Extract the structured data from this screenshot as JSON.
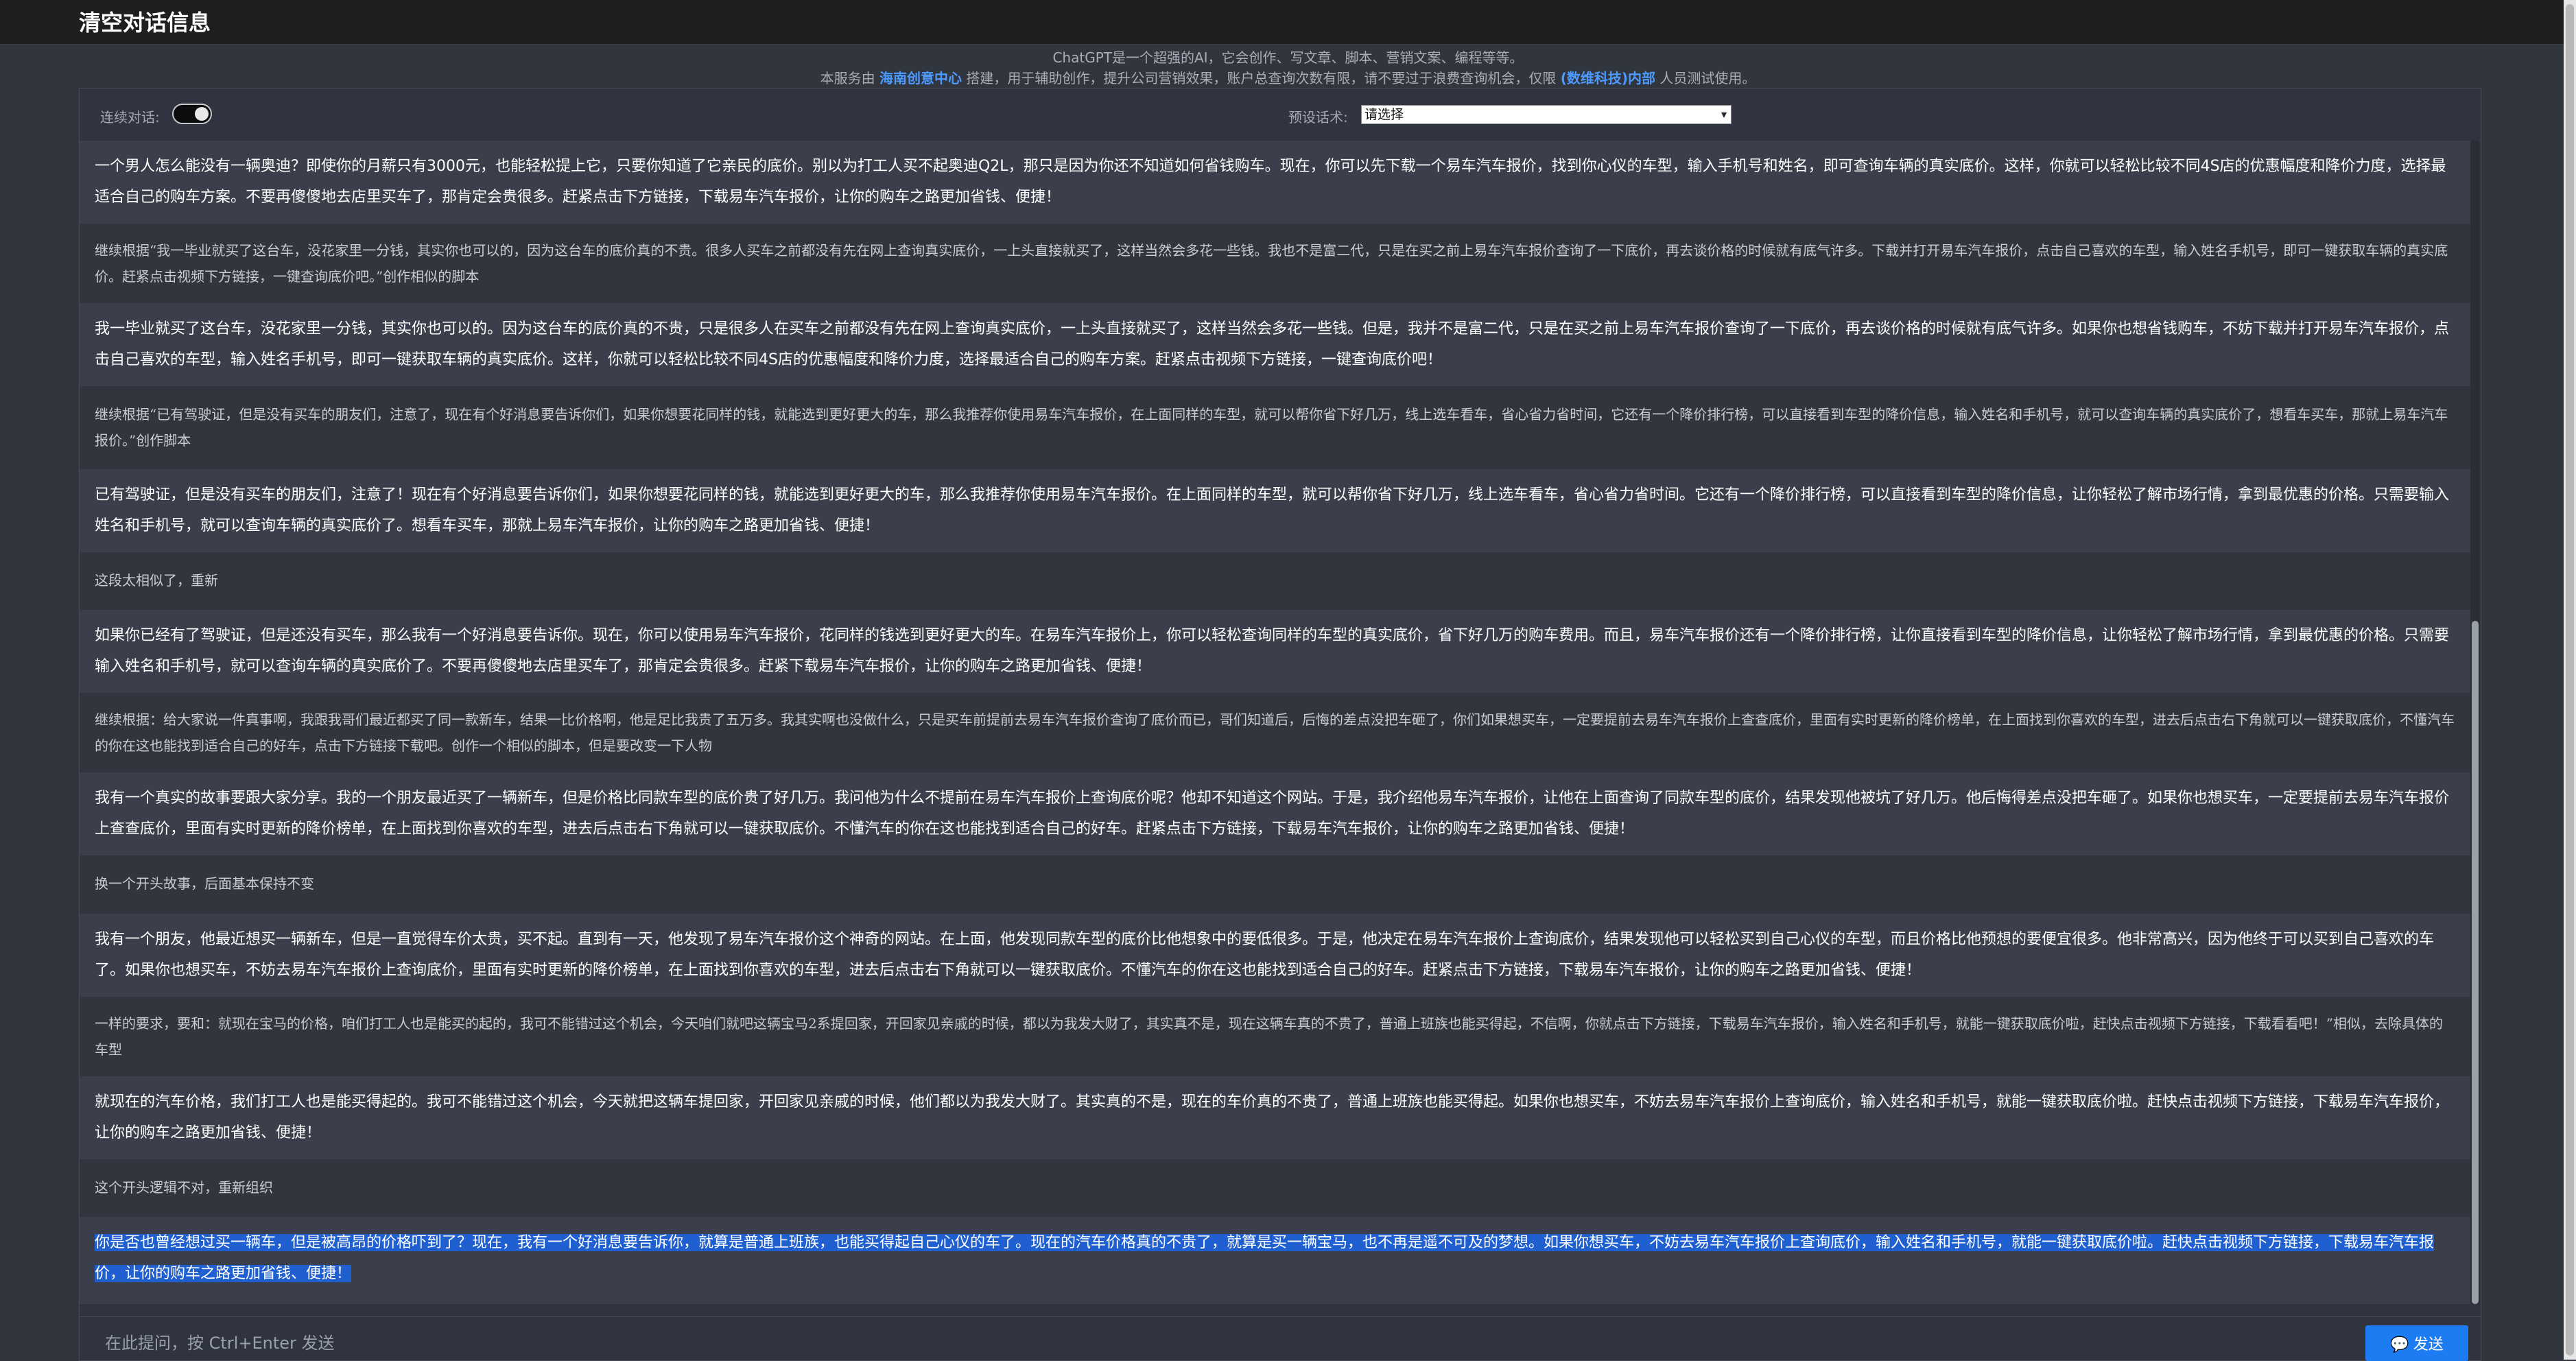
{
  "header": {
    "title": "清空对话信息"
  },
  "notice": {
    "line1": "ChatGPT是一个超强的AI，它会创作、写文章、脚本、营销文案、编程等等。",
    "line2_pre": "本服务由",
    "line2_link1": "海南创意中心",
    "line2_mid": "搭建，用于辅助创作，提升公司营销效果，账户总查询次数有限，请不要过于浪费查询机会，仅限",
    "line2_link2": "(数维科技)内部",
    "line2_post": "人员测试使用。"
  },
  "options": {
    "continuous_label": "连续对话:",
    "preset_label": "预设话术:",
    "preset_value": "请选择"
  },
  "messages": [
    {
      "role": "assistant",
      "text": "一个男人怎么能没有一辆奥迪？即使你的月薪只有3000元，也能轻松提上它，只要你知道了它亲民的底价。别以为打工人买不起奥迪Q2L，那只是因为你还不知道如何省钱购车。现在，你可以先下载一个易车汽车报价，找到你心仪的车型，输入手机号和姓名，即可查询车辆的真实底价。这样，你就可以轻松比较不同4S店的优惠幅度和降价力度，选择最适合自己的购车方案。不要再傻傻地去店里买车了，那肯定会贵很多。赶紧点击下方链接，下载易车汽车报价，让你的购车之路更加省钱、便捷！"
    },
    {
      "role": "user",
      "text": "继续根据“我一毕业就买了这台车，没花家里一分钱，其实你也可以的，因为这台车的底价真的不贵。很多人买车之前都没有先在网上查询真实底价，一上头直接就买了，这样当然会多花一些钱。我也不是富二代，只是在买之前上易车汽车报价查询了一下底价，再去谈价格的时候就有底气许多。下载并打开易车汽车报价，点击自己喜欢的车型，输入姓名手机号，即可一键获取车辆的真实底价。赶紧点击视频下方链接，一键查询底价吧。”创作相似的脚本"
    },
    {
      "role": "assistant",
      "text": "我一毕业就买了这台车，没花家里一分钱，其实你也可以的。因为这台车的底价真的不贵，只是很多人在买车之前都没有先在网上查询真实底价，一上头直接就买了，这样当然会多花一些钱。但是，我并不是富二代，只是在买之前上易车汽车报价查询了一下底价，再去谈价格的时候就有底气许多。如果你也想省钱购车，不妨下载并打开易车汽车报价，点击自己喜欢的车型，输入姓名手机号，即可一键获取车辆的真实底价。这样，你就可以轻松比较不同4S店的优惠幅度和降价力度，选择最适合自己的购车方案。赶紧点击视频下方链接，一键查询底价吧！"
    },
    {
      "role": "user",
      "text": "继续根据“已有驾驶证，但是没有买车的朋友们，注意了，现在有个好消息要告诉你们，如果你想要花同样的钱，就能选到更好更大的车，那么我推荐你使用易车汽车报价，在上面同样的车型，就可以帮你省下好几万，线上选车看车，省心省力省时间，它还有一个降价排行榜，可以直接看到车型的降价信息，输入姓名和手机号，就可以查询车辆的真实底价了，想看车买车，那就上易车汽车报价。”创作脚本"
    },
    {
      "role": "assistant",
      "text": "已有驾驶证，但是没有买车的朋友们，注意了！现在有个好消息要告诉你们，如果你想要花同样的钱，就能选到更好更大的车，那么我推荐你使用易车汽车报价。在上面同样的车型，就可以帮你省下好几万，线上选车看车，省心省力省时间。它还有一个降价排行榜，可以直接看到车型的降价信息，让你轻松了解市场行情，拿到最优惠的价格。只需要输入姓名和手机号，就可以查询车辆的真实底价了。想看车买车，那就上易车汽车报价，让你的购车之路更加省钱、便捷！"
    },
    {
      "role": "user",
      "text": "这段太相似了，重新"
    },
    {
      "role": "assistant",
      "text": "如果你已经有了驾驶证，但是还没有买车，那么我有一个好消息要告诉你。现在，你可以使用易车汽车报价，花同样的钱选到更好更大的车。在易车汽车报价上，你可以轻松查询同样的车型的真实底价，省下好几万的购车费用。而且，易车汽车报价还有一个降价排行榜，让你直接看到车型的降价信息，让你轻松了解市场行情，拿到最优惠的价格。只需要输入姓名和手机号，就可以查询车辆的真实底价了。不要再傻傻地去店里买车了，那肯定会贵很多。赶紧下载易车汽车报价，让你的购车之路更加省钱、便捷！"
    },
    {
      "role": "user",
      "text": "继续根据：给大家说一件真事啊，我跟我哥们最近都买了同一款新车，结果一比价格啊，他是足比我贵了五万多。我其实啊也没做什么，只是买车前提前去易车汽车报价查询了底价而已，哥们知道后，后悔的差点没把车砸了，你们如果想买车，一定要提前去易车汽车报价上查查底价，里面有实时更新的降价榜单，在上面找到你喜欢的车型，进去后点击右下角就可以一键获取底价，不懂汽车的你在这也能找到适合自己的好车，点击下方链接下载吧。创作一个相似的脚本，但是要改变一下人物"
    },
    {
      "role": "assistant",
      "text": "我有一个真实的故事要跟大家分享。我的一个朋友最近买了一辆新车，但是价格比同款车型的底价贵了好几万。我问他为什么不提前在易车汽车报价上查询底价呢？他却不知道这个网站。于是，我介绍他易车汽车报价，让他在上面查询了同款车型的底价，结果发现他被坑了好几万。他后悔得差点没把车砸了。如果你也想买车，一定要提前去易车汽车报价上查查底价，里面有实时更新的降价榜单，在上面找到你喜欢的车型，进去后点击右下角就可以一键获取底价。不懂汽车的你在这也能找到适合自己的好车。赶紧点击下方链接，下载易车汽车报价，让你的购车之路更加省钱、便捷！"
    },
    {
      "role": "user",
      "text": "换一个开头故事，后面基本保持不变"
    },
    {
      "role": "assistant",
      "text": "我有一个朋友，他最近想买一辆新车，但是一直觉得车价太贵，买不起。直到有一天，他发现了易车汽车报价这个神奇的网站。在上面，他发现同款车型的底价比他想象中的要低很多。于是，他决定在易车汽车报价上查询底价，结果发现他可以轻松买到自己心仪的车型，而且价格比他预想的要便宜很多。他非常高兴，因为他终于可以买到自己喜欢的车了。如果你也想买车，不妨去易车汽车报价上查询底价，里面有实时更新的降价榜单，在上面找到你喜欢的车型，进去后点击右下角就可以一键获取底价。不懂汽车的你在这也能找到适合自己的好车。赶紧点击下方链接，下载易车汽车报价，让你的购车之路更加省钱、便捷！"
    },
    {
      "role": "user",
      "text": "一样的要求，要和：就现在宝马的价格，咱们打工人也是能买的起的，我可不能错过这个机会，今天咱们就吧这辆宝马2系提回家，开回家见亲戚的时候，都以为我发大财了，其实真不是，现在这辆车真的不贵了，普通上班族也能买得起，不信啊，你就点击下方链接，下载易车汽车报价，输入姓名和手机号，就能一键获取底价啦，赶快点击视频下方链接，下载看看吧！”相似，去除具体的车型"
    },
    {
      "role": "assistant",
      "text": "就现在的汽车价格，我们打工人也是能买得起的。我可不能错过这个机会，今天就把这辆车提回家，开回家见亲戚的时候，他们都以为我发大财了。其实真的不是，现在的车价真的不贵了，普通上班族也能买得起。如果你也想买车，不妨去易车汽车报价上查询底价，输入姓名和手机号，就能一键获取底价啦。赶快点击视频下方链接，下载易车汽车报价，让你的购车之路更加省钱、便捷！"
    },
    {
      "role": "user",
      "text": "这个开头逻辑不对，重新组织"
    },
    {
      "role": "assistant",
      "text": "你是否也曾经想过买一辆车，但是被高昂的价格吓到了？现在，我有一个好消息要告诉你，就算是普通上班族，也能买得起自己心仪的车了。现在的汽车价格真的不贵了，就算是买一辆宝马，也不再是遥不可及的梦想。如果你想买车，不妨去易车汽车报价上查询底价，输入姓名和手机号，就能一键获取底价啦。赶快点击视频下方链接，下载易车汽车报价，让你的购车之路更加省钱、便捷！",
      "selected": true
    }
  ],
  "input": {
    "placeholder": "在此提问，按 Ctrl+Enter 发送",
    "send_label": "发送",
    "send_icon": "chat-bubble-icon"
  }
}
